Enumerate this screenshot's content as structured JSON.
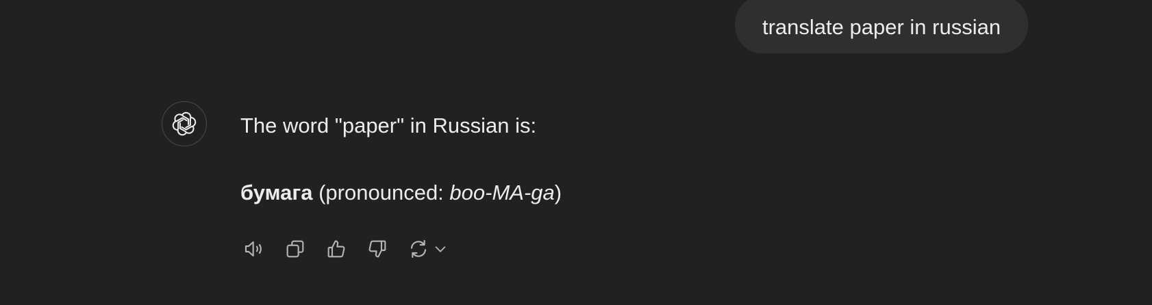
{
  "user_message": {
    "text": "translate paper in russian"
  },
  "assistant_message": {
    "line1": "The word \"paper\" in Russian is:",
    "word": "бумага",
    "pron_open": " (pronounced: ",
    "pron": "boo-MA-ga",
    "pron_close": ")"
  },
  "actions": {
    "icons": [
      "speaker-icon",
      "copy-icon",
      "thumbs-up-icon",
      "thumbs-down-icon",
      "regenerate-icon",
      "chevron-down-icon"
    ]
  },
  "colors": {
    "background": "#212121",
    "bubble": "#2f2f2f",
    "text": "#ececec",
    "icon": "#b4b4b4"
  }
}
